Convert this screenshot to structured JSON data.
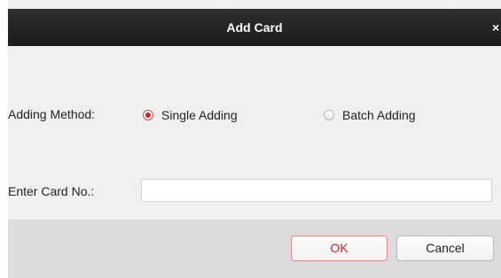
{
  "dialog": {
    "title": "Add Card",
    "close_symbol": "×"
  },
  "form": {
    "adding_method_label": "Adding Method:",
    "methods": [
      {
        "label": "Single Adding",
        "selected": true
      },
      {
        "label": "Batch Adding",
        "selected": false
      }
    ],
    "card_no_label": "Enter Card No.:",
    "card_no_value": "",
    "card_no_placeholder": ""
  },
  "buttons": {
    "ok_label": "OK",
    "cancel_label": "Cancel"
  },
  "colors": {
    "titlebar": "#1f1f1f",
    "accent": "#d9201e",
    "body_bg": "#f0f0f0",
    "footer_bg": "#dcdcdc"
  }
}
